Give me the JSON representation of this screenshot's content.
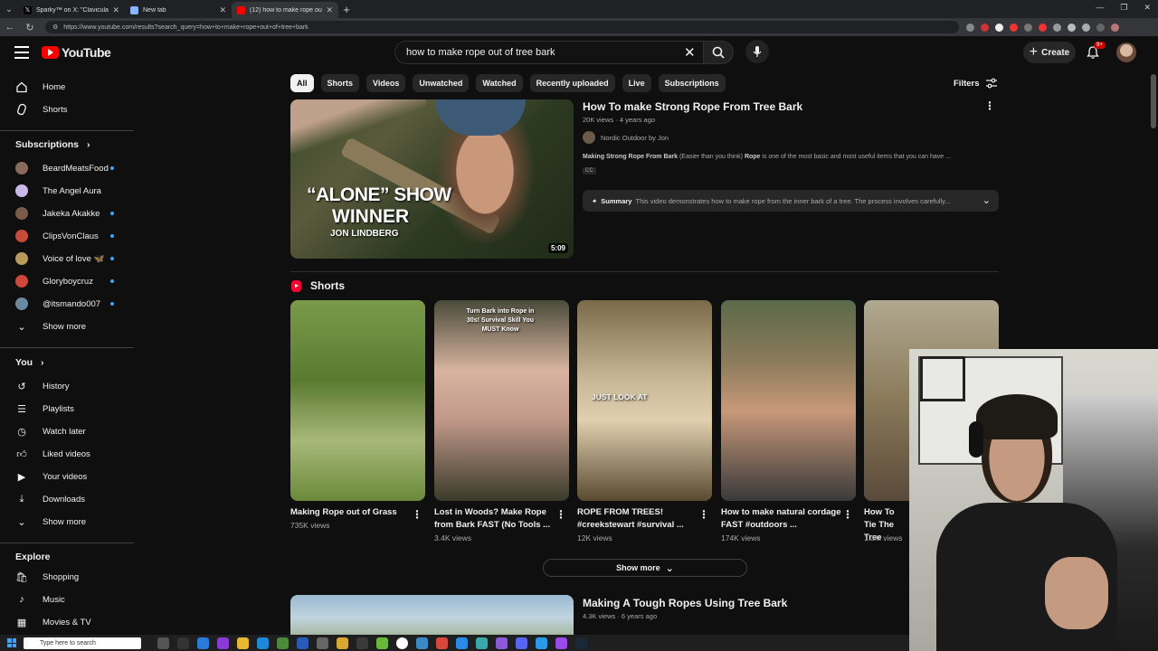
{
  "browser": {
    "tabs": [
      {
        "label": "Sparky™ on X: \"Clavicular just ca...",
        "active": false
      },
      {
        "label": "New tab",
        "active": false
      },
      {
        "label": "(12) how to make rope out of...",
        "active": true
      }
    ],
    "url": "https://www.youtube.com/results?search_query=how+to+make+rope+out+of+tree+bark"
  },
  "masthead": {
    "logo_text": "YouTube",
    "search_value": "how to make rope out of tree bark",
    "create_label": "Create",
    "notification_badge": "9+"
  },
  "sidebar": {
    "main": [
      {
        "label": "Home",
        "icon": "home-icon"
      },
      {
        "label": "Shorts",
        "icon": "shorts-icon"
      }
    ],
    "subscriptions_heading": "Subscriptions",
    "subscriptions": [
      {
        "label": "BeardMeatsFood",
        "dot": true,
        "color": "#8a6a5a"
      },
      {
        "label": "The Angel Aura",
        "dot": false,
        "color": "#c9b8e8"
      },
      {
        "label": "Jakeka Akakke",
        "dot": true,
        "color": "#7a5a4a"
      },
      {
        "label": "ClipsVonClaus",
        "dot": true,
        "color": "#c84a3a"
      },
      {
        "label": "Voice of love 🦋",
        "dot": true,
        "color": "#b89a5a"
      },
      {
        "label": "Gloryboycruz",
        "dot": true,
        "color": "#d0483a"
      },
      {
        "label": "@itsmando007",
        "dot": true,
        "color": "#6a8aa0"
      }
    ],
    "subs_show_more": "Show more",
    "you_heading": "You",
    "you_items": [
      {
        "label": "History",
        "icon": "history-icon"
      },
      {
        "label": "Playlists",
        "icon": "playlists-icon"
      },
      {
        "label": "Watch later",
        "icon": "watch-later-icon"
      },
      {
        "label": "Liked videos",
        "icon": "liked-icon"
      },
      {
        "label": "Your videos",
        "icon": "your-videos-icon"
      },
      {
        "label": "Downloads",
        "icon": "download-icon"
      }
    ],
    "you_show_more": "Show more",
    "explore_heading": "Explore",
    "explore_items": [
      {
        "label": "Shopping",
        "icon": "shopping-icon"
      },
      {
        "label": "Music",
        "icon": "music-icon"
      },
      {
        "label": "Movies & TV",
        "icon": "movies-icon"
      }
    ]
  },
  "chips": [
    "All",
    "Shorts",
    "Videos",
    "Unwatched",
    "Watched",
    "Recently uploaded",
    "Live",
    "Subscriptions"
  ],
  "filters_label": "Filters",
  "video1": {
    "title": "How To make Strong Rope From Tree Bark",
    "meta": "20K views · 4 years ago",
    "channel": "Nordic Outdoor by Jon",
    "desc_bold1": "Making Strong Rope From Bark",
    "desc_mid": " (Easier than you think) ",
    "desc_bold2": "Rope",
    "desc_end": " is one of the most basic and most useful items that you can have ...",
    "badge": "CC",
    "summary_label": "Summary",
    "summary_text": "This video demonstrates how to make rope from the inner bark of a tree. The process involves carefully...",
    "duration": "5:09",
    "thumb_line1": "“ALONE” SHOW",
    "thumb_line2": "WINNER",
    "thumb_line3": "JON LINDBERG"
  },
  "shorts": {
    "heading": "Shorts",
    "items": [
      {
        "title": "Making Rope out of Grass",
        "views": "735K views",
        "overlay": ""
      },
      {
        "title": "Lost in Woods? Make Rope from Bark FAST (No Tools ...",
        "views": "3.4K views",
        "overlay": "Turn Bark into Rope in 30s! Survival Skill You MUST Know"
      },
      {
        "title": "ROPE FROM TREES! #creekstewart #survival ...",
        "views": "12K views",
        "overlay": "JUST LOOK AT"
      },
      {
        "title": "How to make natural cordage FAST #outdoors ...",
        "views": "174K views",
        "overlay": ""
      },
      {
        "title": "How To Tie The Tree",
        "views": "1.3M views",
        "overlay": ""
      }
    ],
    "show_more": "Show more"
  },
  "video2": {
    "title": "Making A Tough Ropes Using Tree Bark",
    "meta": "4.3K views · 6 years ago"
  },
  "taskbar": {
    "search_placeholder": "Type here to search"
  }
}
